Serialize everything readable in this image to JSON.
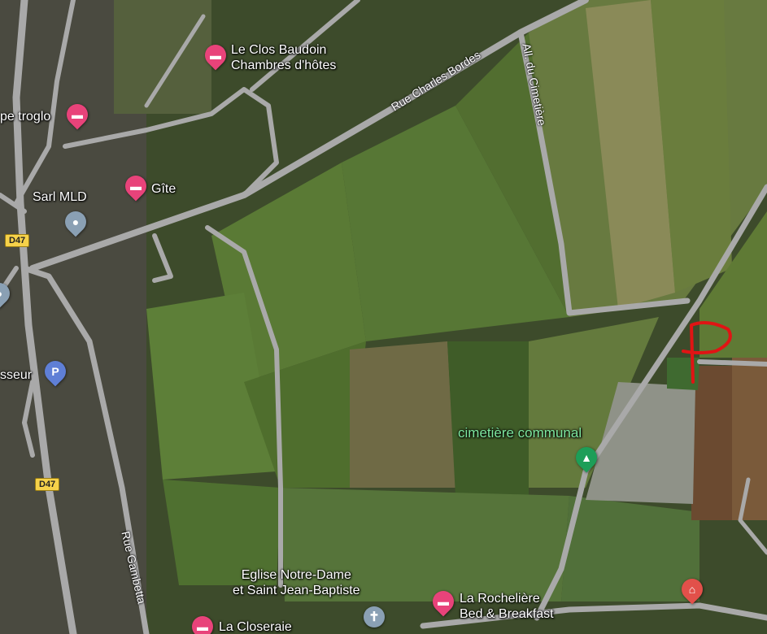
{
  "map": {
    "roads": {
      "rue_charles_bordes": "Rue Charles Bordes",
      "all_du_cimetiere": "All. du Cimetière",
      "rue_gambetta": "Rue Gambetta"
    },
    "route_badges": {
      "d47_top": "D47",
      "d47_bottom": "D47"
    },
    "places": {
      "clos_baudoin_line1": "Le Clos Baudoin",
      "clos_baudoin_line2": "Chambres d'hôtes",
      "troglo": "pe troglo",
      "gite": "Gîte",
      "sarl_mld": "Sarl MLD",
      "sseur": "sseur",
      "cimetiere": "cimetière communal",
      "eglise_line1": "Eglise Notre-Dame",
      "eglise_line2": "et Saint Jean-Baptiste",
      "rocheliere_line1": "La Rochelière",
      "rocheliere_line2": "Bed & Breakfast",
      "closeraie": "La Closeraie"
    },
    "annotation": "P",
    "icons": {
      "lodging": "bed-icon",
      "parking": "parking-icon",
      "generic": "location-pin-icon",
      "cemetery": "tree-icon",
      "church": "cross-icon",
      "health": "house-cross-icon"
    },
    "colors": {
      "lodging_pin": "#e8437a",
      "parking_pin": "#5f7fd6",
      "cemetery_label": "#7ee8a0",
      "annotation": "#e01414",
      "road": "#a9a9a9"
    }
  }
}
